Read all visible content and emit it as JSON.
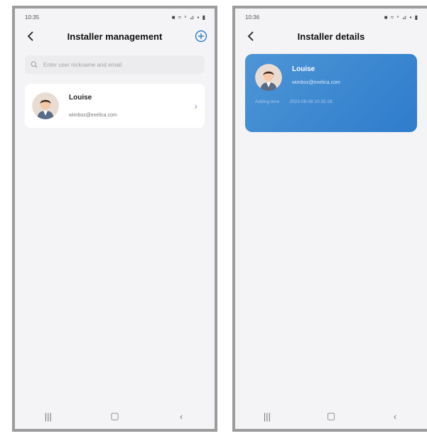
{
  "left": {
    "status": {
      "time": "10:35",
      "icons": "■ ≈ ⁿ ⊿ ▪ ▮"
    },
    "header": {
      "title": "Installer management"
    },
    "search": {
      "placeholder": "Enter user nickname and email"
    },
    "user": {
      "name": "Louise",
      "email": "wimboz@exelica.com"
    }
  },
  "right": {
    "status": {
      "time": "10:36",
      "icons": "■ ≈ ⁿ ⊿ ▪ ▮"
    },
    "header": {
      "title": "Installer details"
    },
    "card": {
      "name": "Louise",
      "email": "wimboz@exelica.com",
      "adding_time_label": "Adding time",
      "adding_time": "2023-08-08 10:35:28"
    }
  },
  "nav": {
    "recents": "|||",
    "home": "▢",
    "back": "‹"
  },
  "colors": {
    "accent": "#2f7ccc",
    "card_gradient_start": "#4d95d6",
    "background": "#f4f4f6"
  },
  "icons": [
    "back-arrow-icon",
    "add-circle-icon",
    "search-icon",
    "avatar",
    "chevron-right-icon",
    "recents-icon",
    "home-icon",
    "back-icon"
  ]
}
